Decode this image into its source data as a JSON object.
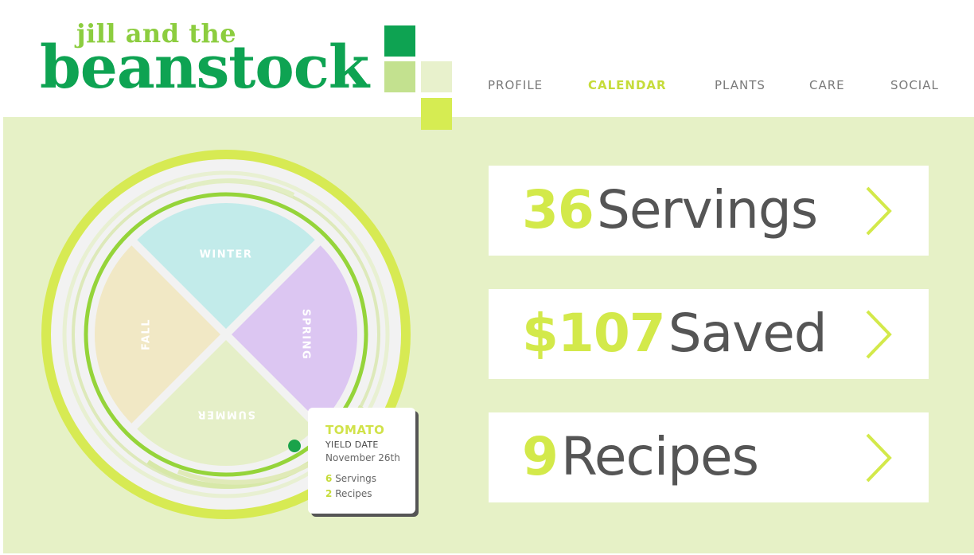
{
  "header": {
    "logo_line1": "jill and the",
    "logo_line2": "beanstock",
    "nav": [
      {
        "label": "PROFILE",
        "active": false
      },
      {
        "label": "CALENDAR",
        "active": true
      },
      {
        "label": "PLANTS",
        "active": false
      },
      {
        "label": "CARE",
        "active": false
      },
      {
        "label": "SOCIAL",
        "active": false
      }
    ]
  },
  "wheel": {
    "seasons": [
      {
        "label": "WINTER",
        "color": "#c2ebea"
      },
      {
        "label": "SPRING",
        "color": "#dcc6f2"
      },
      {
        "label": "SUMMER",
        "color": "#e5efc8"
      },
      {
        "label": "FALL",
        "color": "#f1e8c5"
      }
    ]
  },
  "tooltip": {
    "title": "TOMATO",
    "subtitle": "YIELD DATE",
    "date": "November 26th",
    "servings_num": "6",
    "servings_label": "Servings",
    "recipes_num": "2",
    "recipes_label": "Recipes"
  },
  "stats": [
    {
      "value": "36",
      "label": "Servings"
    },
    {
      "value": "$107",
      "label": "Saved"
    },
    {
      "value": "9",
      "label": "Recipes"
    }
  ],
  "colors": {
    "brand_green": "#0ea352",
    "lime": "#d3e94a",
    "panel_bg": "#e6f1c6"
  },
  "icons": [
    "chevron-right-icon",
    "location-marker-icon"
  ]
}
